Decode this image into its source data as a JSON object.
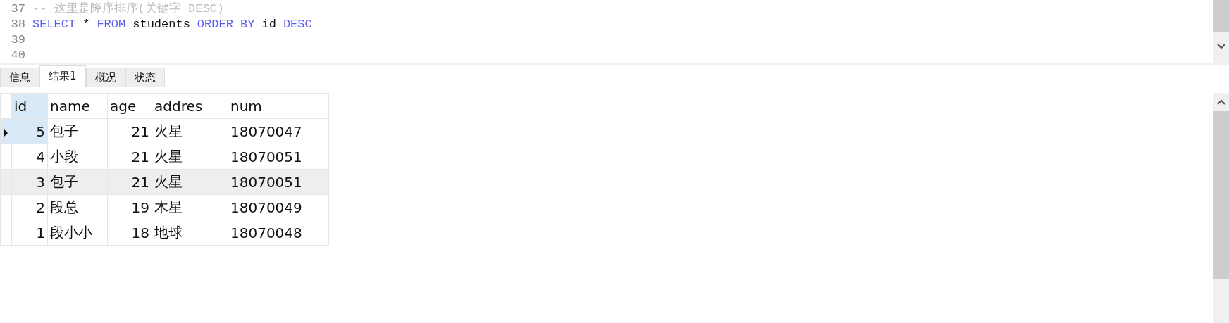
{
  "editor": {
    "lines": [
      {
        "number": "37",
        "tokens": [
          {
            "text": "-- 这里是降序排序(关键字 DESC)",
            "kind": "comment"
          }
        ]
      },
      {
        "number": "38",
        "tokens": [
          {
            "text": "SELECT",
            "kind": "keyword"
          },
          {
            "text": "*",
            "kind": "plain"
          },
          {
            "text": "FROM",
            "kind": "keyword"
          },
          {
            "text": "students",
            "kind": "plain"
          },
          {
            "text": "ORDER BY",
            "kind": "keyword"
          },
          {
            "text": "id",
            "kind": "plain"
          },
          {
            "text": "DESC",
            "kind": "keyword"
          }
        ]
      },
      {
        "number": "39"
      },
      {
        "number": "40"
      }
    ]
  },
  "tabs": [
    {
      "label": "信息",
      "selected": false
    },
    {
      "label": "结果1",
      "selected": true
    },
    {
      "label": "概况",
      "selected": false
    },
    {
      "label": "状态",
      "selected": false
    }
  ],
  "table": {
    "columns": [
      {
        "label": "id",
        "selected": true
      },
      {
        "label": "name",
        "selected": false
      },
      {
        "label": "age",
        "selected": false
      },
      {
        "label": "addres",
        "selected": false
      },
      {
        "label": "num",
        "selected": false
      }
    ],
    "rows": [
      {
        "selected": true,
        "hover": false,
        "cells": [
          "5",
          "包子",
          "21",
          "火星",
          "18070047"
        ]
      },
      {
        "selected": false,
        "hover": false,
        "cells": [
          "4",
          "小段",
          "21",
          "火星",
          "18070051"
        ]
      },
      {
        "selected": false,
        "hover": true,
        "cells": [
          "3",
          "包子",
          "21",
          "火星",
          "18070051"
        ]
      },
      {
        "selected": false,
        "hover": false,
        "cells": [
          "2",
          "段总",
          "19",
          "木星",
          "18070049"
        ]
      },
      {
        "selected": false,
        "hover": false,
        "cells": [
          "1",
          "段小小",
          "18",
          "地球",
          "18070048"
        ]
      }
    ]
  }
}
